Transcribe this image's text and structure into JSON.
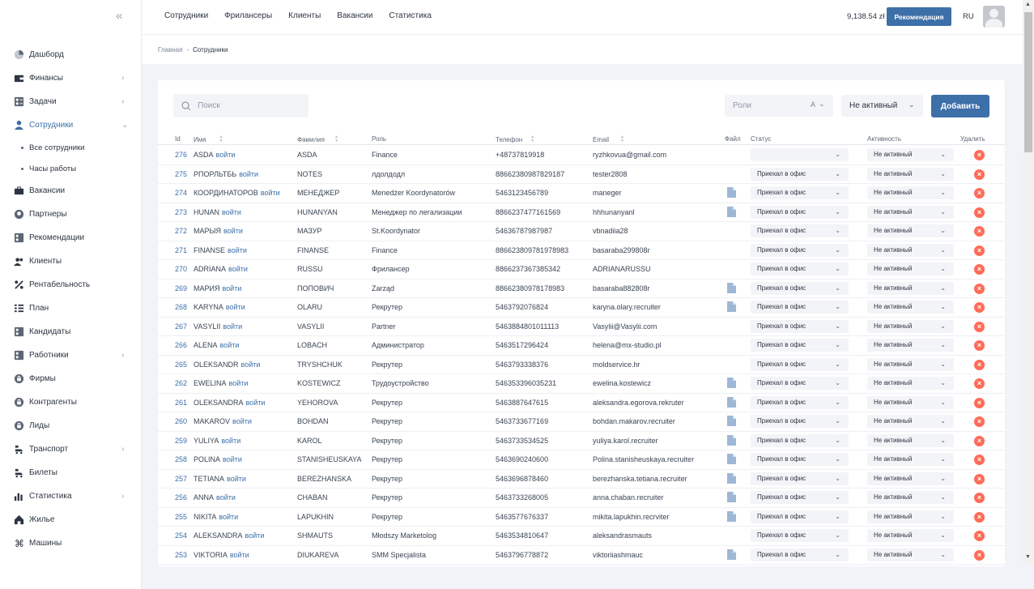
{
  "sidebar": {
    "collapse": "«",
    "items": [
      {
        "label": "Дашборд",
        "icon": "pie-chart-icon",
        "chev": ""
      },
      {
        "label": "Финансы",
        "icon": "wallet-icon",
        "chev": "›"
      },
      {
        "label": "Задачи",
        "icon": "tasks-icon",
        "chev": "›"
      },
      {
        "label": "Сотрудники",
        "icon": "user-icon",
        "chev": "⌄"
      },
      {
        "label": "Вакансии",
        "icon": "briefcase-icon",
        "chev": ""
      },
      {
        "label": "Партнеры",
        "icon": "partner-icon",
        "chev": ""
      },
      {
        "label": "Рекомендации",
        "icon": "recommend-icon",
        "chev": ""
      },
      {
        "label": "Клиенты",
        "icon": "clients-icon",
        "chev": ""
      },
      {
        "label": "Рентабельность",
        "icon": "percent-icon",
        "chev": ""
      },
      {
        "label": "План",
        "icon": "plan-icon",
        "chev": ""
      },
      {
        "label": "Кандидаты",
        "icon": "candidates-icon",
        "chev": ""
      },
      {
        "label": "Работники",
        "icon": "workers-icon",
        "chev": "›"
      },
      {
        "label": "Фирмы",
        "icon": "lock-icon",
        "chev": ""
      },
      {
        "label": "Контрагенты",
        "icon": "lock-icon",
        "chev": ""
      },
      {
        "label": "Лиды",
        "icon": "lock-icon",
        "chev": ""
      },
      {
        "label": "Транспорт",
        "icon": "transport-icon",
        "chev": "›"
      },
      {
        "label": "Билеты",
        "icon": "ticket-icon",
        "chev": ""
      },
      {
        "label": "Статистика",
        "icon": "bar-chart-icon",
        "chev": "›"
      },
      {
        "label": "Жилье",
        "icon": "home-icon",
        "chev": ""
      },
      {
        "label": "Машины",
        "icon": "command-icon",
        "chev": ""
      }
    ],
    "sub_items": [
      "Все сотрудники",
      "Часы работы"
    ]
  },
  "header": {
    "nav": [
      "Сотрудники",
      "Фрилансеры",
      "Клиенты",
      "Вакансии",
      "Статистика"
    ],
    "balance": "9,138.54 zł",
    "recommend_label": "Рекомендация",
    "lang": "RU"
  },
  "breadcrumb": {
    "home": "Главная",
    "sep": "-",
    "current": "Сотрудники"
  },
  "toolbar": {
    "search_placeholder": "Поиск",
    "roles_placeholder": "Роли",
    "roles_suffix": "A",
    "status_filter": "Не активный",
    "add_label": "Добавить"
  },
  "table": {
    "columns": {
      "id": "Id",
      "name": "Имя",
      "surname": "Фамилия",
      "role": "Роль",
      "phone": "Телефон",
      "email": "Email",
      "file": "Файл",
      "status": "Статус",
      "activity": "Активность",
      "delete": "Удалить"
    },
    "login_label": "войти",
    "rows": [
      {
        "id": "276",
        "name": "ASDA",
        "surname": "ASDA",
        "role": "Finance",
        "phone": "+48737819918",
        "email": "ryzhkovua@gmail.com",
        "file": false,
        "status": "",
        "activity": "Не активный"
      },
      {
        "id": "275",
        "name": "РПОРЛЬТБЬ",
        "surname": "NOTES",
        "role": "лдолдодл",
        "phone": "88662380987829187",
        "email": "tester2808",
        "file": false,
        "status": "Приехал в офис",
        "activity": "Не активный"
      },
      {
        "id": "274",
        "name": "КООРДИНАТОРОВ",
        "surname": "МЕНЕДЖЕР",
        "role": "Menedżer Koordynatorów",
        "phone": "5463123456789",
        "email": "maneger",
        "file": true,
        "status": "Приехал в офис",
        "activity": "Не активный"
      },
      {
        "id": "273",
        "name": "HUNAN",
        "surname": "HUNANYAN",
        "role": "Менеджер по легализации",
        "phone": "8866237477161569",
        "email": "hhhunanyanl",
        "file": true,
        "status": "Приехал в офис",
        "activity": "Не активный"
      },
      {
        "id": "272",
        "name": "МАРЫЯ",
        "surname": "МАЗУР",
        "role": "St.Koordynator",
        "phone": "54636787987987",
        "email": "vbnadiia28",
        "file": false,
        "status": "Приехал в офис",
        "activity": "Не активный"
      },
      {
        "id": "271",
        "name": "FINANSE",
        "surname": "FINANSE",
        "role": "Finance",
        "phone": "886623809781978983",
        "email": "basaraba299808r",
        "file": false,
        "status": "Приехал в офис",
        "activity": "Не активный"
      },
      {
        "id": "270",
        "name": "ADRIANA",
        "surname": "RUSSU",
        "role": "Фрилансер",
        "phone": "8866237367385342",
        "email": "ADRIANARUSSU",
        "file": false,
        "status": "Приехал в офис",
        "activity": "Не активный"
      },
      {
        "id": "269",
        "name": "МАРИЯ",
        "surname": "ПОПОВИЧ",
        "role": "Zarząd",
        "phone": "88662380978178983",
        "email": "basaraba882808r",
        "file": true,
        "status": "Приехал в офис",
        "activity": "Не активный"
      },
      {
        "id": "268",
        "name": "KARYNA",
        "surname": "OLARU",
        "role": "Рекрутер",
        "phone": "5463792076824",
        "email": "karyna.olary.recruiter",
        "file": true,
        "status": "Приехал в офис",
        "activity": "Не активный"
      },
      {
        "id": "267",
        "name": "VASYLII",
        "surname": "VASYLII",
        "role": "Partner",
        "phone": "5463884801011113",
        "email": "Vasylii@Vasylii.com",
        "file": false,
        "status": "Приехал в офис",
        "activity": "Не активный"
      },
      {
        "id": "266",
        "name": "ALENA",
        "surname": "LOBACH",
        "role": "Администратор",
        "phone": "5463517296424",
        "email": "helena@mx-studio.pl",
        "file": false,
        "status": "Приехал в офис",
        "activity": "Не активный"
      },
      {
        "id": "265",
        "name": "OLEKSANDR",
        "surname": "TRYSHCHUK",
        "role": "Рекрутер",
        "phone": "5463793338376",
        "email": "moldservice.hr",
        "file": false,
        "status": "Приехал в офис",
        "activity": "Не активный"
      },
      {
        "id": "262",
        "name": "EWELINA",
        "surname": "KOSTEWICZ",
        "role": "Трудоустройство",
        "phone": "546353396035231",
        "email": "ewelina.kostewicz",
        "file": true,
        "status": "Приехал в офис",
        "activity": "Не активный"
      },
      {
        "id": "261",
        "name": "OLEKSANDRA",
        "surname": "YEHOROVA",
        "role": "Рекрутер",
        "phone": "5463887647615",
        "email": "aleksandra.egorova.rekruter",
        "file": true,
        "status": "Приехал в офис",
        "activity": "Не активный"
      },
      {
        "id": "260",
        "name": "MAKAROV",
        "surname": "BOHDAN",
        "role": "Рекрутер",
        "phone": "5463733677169",
        "email": "bohdan.makarov.recruiter",
        "file": true,
        "status": "Приехал в офис",
        "activity": "Не активный"
      },
      {
        "id": "259",
        "name": "YULIYA",
        "surname": "KAROL",
        "role": "Рекрутер",
        "phone": "5463733534525",
        "email": "yuliya.karol.recruiter",
        "file": true,
        "status": "Приехал в офис",
        "activity": "Не активный"
      },
      {
        "id": "258",
        "name": "POLINA",
        "surname": "STANISHEUSKAYA",
        "role": "Рекрутер",
        "phone": "5463690240600",
        "email": "Polina.stanisheuskaya.recruiter",
        "file": true,
        "status": "Приехал в офис",
        "activity": "Не активный"
      },
      {
        "id": "257",
        "name": "TETIANA",
        "surname": "BEREZHANSKA",
        "role": "Рекрутер",
        "phone": "5463696878460",
        "email": "berezhanska.tetiana.recruiter",
        "file": true,
        "status": "Приехал в офис",
        "activity": "Не активный"
      },
      {
        "id": "256",
        "name": "ANNA",
        "surname": "CHABAN",
        "role": "Рекрутер",
        "phone": "5463733268005",
        "email": "anna.chaban.recruiter",
        "file": true,
        "status": "Приехал в офис",
        "activity": "Не активный"
      },
      {
        "id": "255",
        "name": "NIKITA",
        "surname": "LAPUKHIN",
        "role": "Рекрутер",
        "phone": "5463577676337",
        "email": "mikita.lapukhin.recrviter",
        "file": true,
        "status": "Приехал в офис",
        "activity": "Не активный"
      },
      {
        "id": "254",
        "name": "ALEKSANDRA",
        "surname": "SHMAUTS",
        "role": "Młodszy Marketolog",
        "phone": "5463534810647",
        "email": "aleksandrasmauts",
        "file": false,
        "status": "Приехал в офис",
        "activity": "Не активный"
      },
      {
        "id": "253",
        "name": "VIKTORIA",
        "surname": "DIUKAREVA",
        "role": "SMM Specjalista",
        "phone": "5463796778872",
        "email": "viktoriiashmauc",
        "file": true,
        "status": "Приехал в офис",
        "activity": "Не активный"
      }
    ]
  },
  "colors": {
    "accent": "#3d6fa8",
    "delete": "#ff6b57",
    "field_bg": "#f3f4f7"
  }
}
